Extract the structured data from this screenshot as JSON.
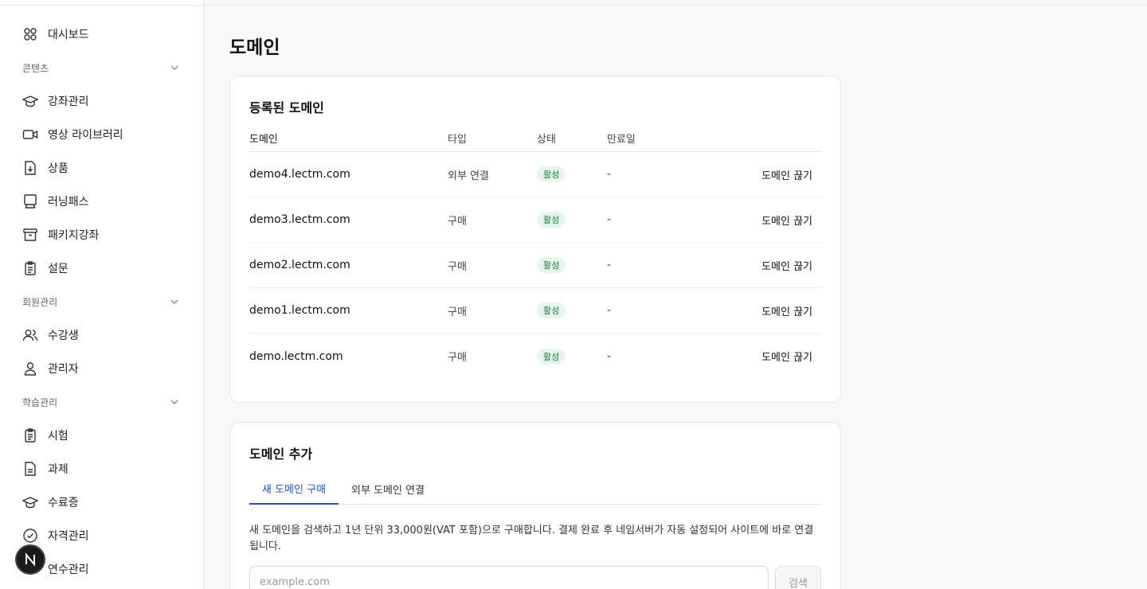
{
  "sidebar": {
    "dashboard": "대시보드",
    "sections": [
      {
        "label": "콘텐츠",
        "items": [
          "강좌관리",
          "영상 라이브러리",
          "상품",
          "러닝패스",
          "패키지강좌",
          "설문"
        ]
      },
      {
        "label": "회원관리",
        "items": [
          "수강생",
          "관리자"
        ]
      },
      {
        "label": "학습관리",
        "items": [
          "시험",
          "과제",
          "수료증",
          "자격관리",
          "연수관리"
        ]
      }
    ],
    "fab_letter": "N"
  },
  "page": {
    "title": "도메인"
  },
  "registered": {
    "title": "등록된 도메인",
    "columns": [
      "도메인",
      "타입",
      "상태",
      "만료일"
    ],
    "rows": [
      {
        "domain": "demo4.lectm.com",
        "type": "외부 연결",
        "status": "활성",
        "expire": "-",
        "action": "도메인 끊기"
      },
      {
        "domain": "demo3.lectm.com",
        "type": "구매",
        "status": "활성",
        "expire": "-",
        "action": "도메인 끊기"
      },
      {
        "domain": "demo2.lectm.com",
        "type": "구매",
        "status": "활성",
        "expire": "-",
        "action": "도메인 끊기"
      },
      {
        "domain": "demo1.lectm.com",
        "type": "구매",
        "status": "활성",
        "expire": "-",
        "action": "도메인 끊기"
      },
      {
        "domain": "demo.lectm.com",
        "type": "구매",
        "status": "활성",
        "expire": "-",
        "action": "도메인 끊기"
      }
    ]
  },
  "add": {
    "title": "도메인 추가",
    "tabs": [
      "새 도메인 구매",
      "외부 도메인 연결"
    ],
    "description": "새 도메인을 검색하고 1년 단위 33,000원(VAT 포함)으로 구매합니다. 결제 완료 후 네임서버가 자동 설정되어 사이트에 바로 연결됩니다.",
    "search_placeholder": "example.com",
    "search_label": "검색"
  }
}
